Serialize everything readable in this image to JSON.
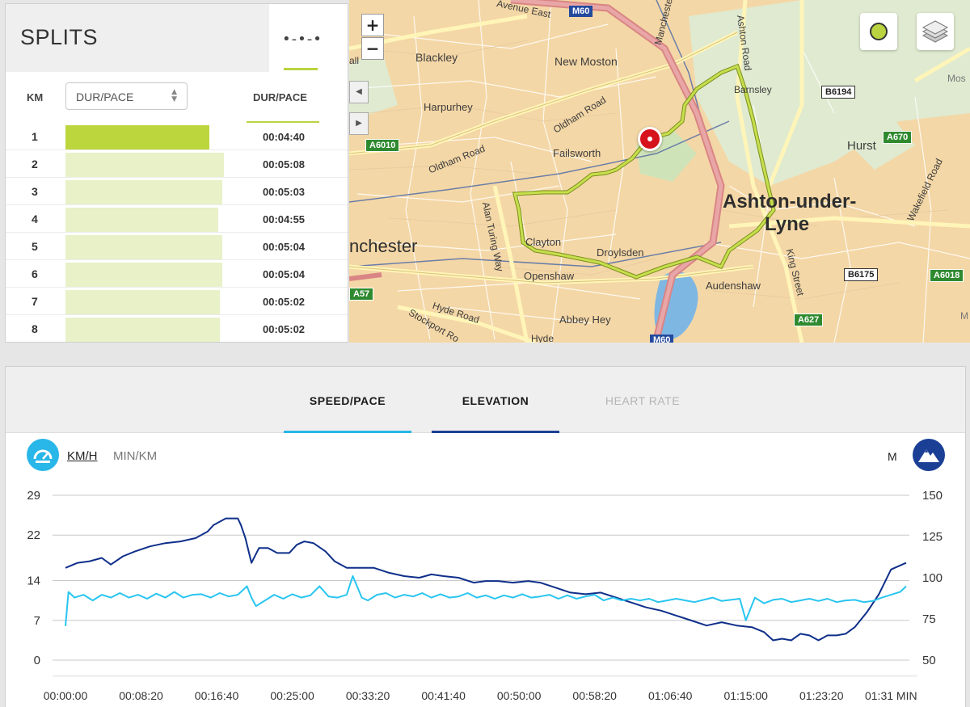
{
  "splits": {
    "title": "SPLITS",
    "tab_icon": "•-•-•",
    "col_km": "KM",
    "select_label": "DUR/PACE",
    "col_value": "DUR/PACE",
    "rows": [
      {
        "km": "1",
        "time": "00:04:40",
        "pace_fraction": 0.81
      },
      {
        "km": "2",
        "time": "00:05:08",
        "pace_fraction": 0.89
      },
      {
        "km": "3",
        "time": "00:05:03",
        "pace_fraction": 0.88
      },
      {
        "km": "4",
        "time": "00:04:55",
        "pace_fraction": 0.86
      },
      {
        "km": "5",
        "time": "00:05:04",
        "pace_fraction": 0.88
      },
      {
        "km": "6",
        "time": "00:05:04",
        "pace_fraction": 0.88
      },
      {
        "km": "7",
        "time": "00:05:02",
        "pace_fraction": 0.87
      },
      {
        "km": "8",
        "time": "00:05:02",
        "pace_fraction": 0.87
      }
    ],
    "active_row": 0,
    "bar_color": "#e8f1c8",
    "active_color": "#bcd63e"
  },
  "map": {
    "zoom_in": "+",
    "zoom_out": "−",
    "pan_left": "◀",
    "pan_right": "▶",
    "labels": {
      "blackley": "Blackley",
      "new_moston": "New Moston",
      "harpurhey": "Harpurhey",
      "failsworth": "Failsworth",
      "oldham_road_1": "Oldham Road",
      "oldham_road_2": "Oldham Road",
      "hurst": "Hurst",
      "ashton": "Ashton-under-",
      "lyne": "Lyne",
      "manchester": "nchester",
      "clayton": "Clayton",
      "droylsden": "Droylsden",
      "openshaw": "Openshaw",
      "audenshaw": "Audenshaw",
      "abbey_hey": "Abbey Hey",
      "hyde_road": "Hyde Road",
      "stockport_road": "Stockport Ro",
      "alan_turing_way": "Alan Turing Way",
      "ashton_road": "Ashton Road",
      "barnsley": "Barnsley",
      "king_street": "King Street",
      "wakefield_road": "Wakefield Road",
      "avenue_east": "Avenue East",
      "manchester_rd": "Manchester",
      "mos": "Mos",
      "hyde": "Hyde",
      "all": "all",
      "m_cut": "M"
    },
    "shields": {
      "m60_top": "M60",
      "m60_bottom": "M60",
      "a6010": "A6010",
      "a57": "A57",
      "a670": "A670",
      "a6018": "A6018",
      "a627": "A627",
      "b6194": "B6194",
      "b6175": "B6175"
    },
    "route_color": "#b6cf3a",
    "marker_color": "#d6121d",
    "layer_toggle_color": "#b9d440"
  },
  "chart": {
    "tabs": [
      {
        "label": "SPEED/PACE",
        "state": "active",
        "color": "#1a1a1a",
        "underline": "#29b6e8"
      },
      {
        "label": "ELEVATION",
        "state": "active",
        "color": "#1a1a1a",
        "underline": "#1b3f95"
      },
      {
        "label": "HEART RATE",
        "state": "disabled",
        "color": "#b5b5b5",
        "underline": ""
      }
    ],
    "unit_speed": "KM/H",
    "unit_pace": "MIN/KM",
    "unit_elevation": "M",
    "speed_color": "#29c5f0",
    "elevation_color": "#0f2f8a"
  },
  "chart_data": {
    "type": "line",
    "left_axis": {
      "ticks": [
        "29",
        "22",
        "14",
        "7",
        "0"
      ],
      "values": [
        29,
        22,
        14,
        7,
        0
      ],
      "unit": "KM/H"
    },
    "right_axis": {
      "ticks": [
        "150",
        "125",
        "100",
        "75",
        "50"
      ],
      "values": [
        150,
        125,
        100,
        75,
        50
      ],
      "unit": "M"
    },
    "x_ticks": [
      "00:00:00",
      "00:08:20",
      "00:16:40",
      "00:25:00",
      "00:33:20",
      "00:41:40",
      "00:50:00",
      "00:58:20",
      "01:06:40",
      "01:15:00",
      "01:23:20",
      "01:31 MIN"
    ],
    "x_tick_seconds": [
      0,
      500,
      1000,
      1500,
      2000,
      2500,
      3000,
      3500,
      4000,
      4500,
      5000,
      5460
    ],
    "x_range": [
      0,
      5560
    ],
    "series": [
      {
        "axis": "right",
        "x": [
          0,
          80,
          160,
          240,
          300,
          380,
          460,
          560,
          660,
          760,
          860,
          940,
          980,
          1060,
          1140,
          1160,
          1190,
          1230,
          1280,
          1340,
          1400,
          1480,
          1530,
          1580,
          1640,
          1720,
          1780,
          1860,
          1940,
          2040,
          2140,
          2240,
          2340,
          2420,
          2500,
          2600,
          2700,
          2780,
          2860,
          2960,
          3060,
          3140,
          3240,
          3340,
          3440,
          3540,
          3640,
          3740,
          3840,
          3940,
          4040,
          4140,
          4240,
          4340,
          4440,
          4540,
          4620,
          4680,
          4740,
          4800,
          4860,
          4920,
          4980,
          5040,
          5100,
          5160,
          5220,
          5300,
          5380,
          5460,
          5560
        ],
        "values": [
          106,
          109,
          110,
          112,
          108,
          113,
          116,
          119,
          121,
          122,
          124,
          128,
          132,
          136,
          136,
          132,
          124,
          109,
          118,
          118,
          115,
          115,
          120,
          122,
          121,
          116,
          110,
          106,
          106,
          106,
          103,
          101,
          100,
          102,
          101,
          100,
          97,
          98,
          98,
          97,
          98,
          97,
          94,
          91,
          90,
          91,
          88,
          85,
          82,
          80,
          77,
          74,
          71,
          73,
          71,
          70,
          67,
          62,
          63,
          62,
          66,
          65,
          62,
          65,
          65,
          66,
          70,
          79,
          90,
          105,
          109
        ]
      },
      {
        "axis": "left",
        "x": [
          0,
          20,
          60,
          120,
          180,
          240,
          300,
          360,
          420,
          480,
          540,
          600,
          660,
          720,
          780,
          840,
          900,
          960,
          1020,
          1080,
          1140,
          1200,
          1230,
          1260,
          1320,
          1380,
          1440,
          1500,
          1560,
          1620,
          1680,
          1740,
          1800,
          1860,
          1900,
          1960,
          2000,
          2060,
          2120,
          2180,
          2240,
          2300,
          2360,
          2420,
          2480,
          2540,
          2600,
          2660,
          2720,
          2780,
          2840,
          2900,
          2960,
          3020,
          3080,
          3140,
          3200,
          3260,
          3320,
          3380,
          3440,
          3500,
          3560,
          3620,
          3680,
          3740,
          3800,
          3860,
          3920,
          3980,
          4040,
          4100,
          4160,
          4220,
          4280,
          4340,
          4400,
          4460,
          4500,
          4560,
          4620,
          4680,
          4740,
          4800,
          4860,
          4920,
          4980,
          5040,
          5100,
          5160,
          5220,
          5280,
          5340,
          5400,
          5460,
          5520,
          5560
        ],
        "values": [
          6,
          12,
          11,
          11.5,
          10.5,
          11.5,
          11,
          11.8,
          11,
          11.5,
          10.8,
          11.7,
          11,
          12,
          11,
          11.5,
          11.6,
          11,
          11.8,
          11.2,
          11.5,
          13,
          11,
          9.5,
          10.5,
          11.5,
          10.8,
          11.6,
          11,
          11.4,
          13,
          11.2,
          11,
          11.5,
          14.8,
          11,
          10.5,
          11.5,
          11.8,
          11,
          11.5,
          11.2,
          11.8,
          11,
          11.6,
          11,
          11.2,
          11.8,
          11,
          11.4,
          10.8,
          11.4,
          11,
          11.6,
          11,
          11.2,
          11.5,
          10.8,
          11.4,
          10.8,
          11.2,
          11.5,
          10.5,
          11,
          10.5,
          10.8,
          10.5,
          10.8,
          10.2,
          10.5,
          10.8,
          10.5,
          10.2,
          10.6,
          11,
          10.4,
          10.6,
          10.8,
          7,
          11,
          10,
          10.6,
          10.8,
          10.2,
          10.5,
          10.8,
          10.4,
          10.8,
          10.2,
          10.5,
          10.6,
          10.2,
          10.4,
          11,
          11.5,
          12,
          13
        ]
      }
    ]
  }
}
